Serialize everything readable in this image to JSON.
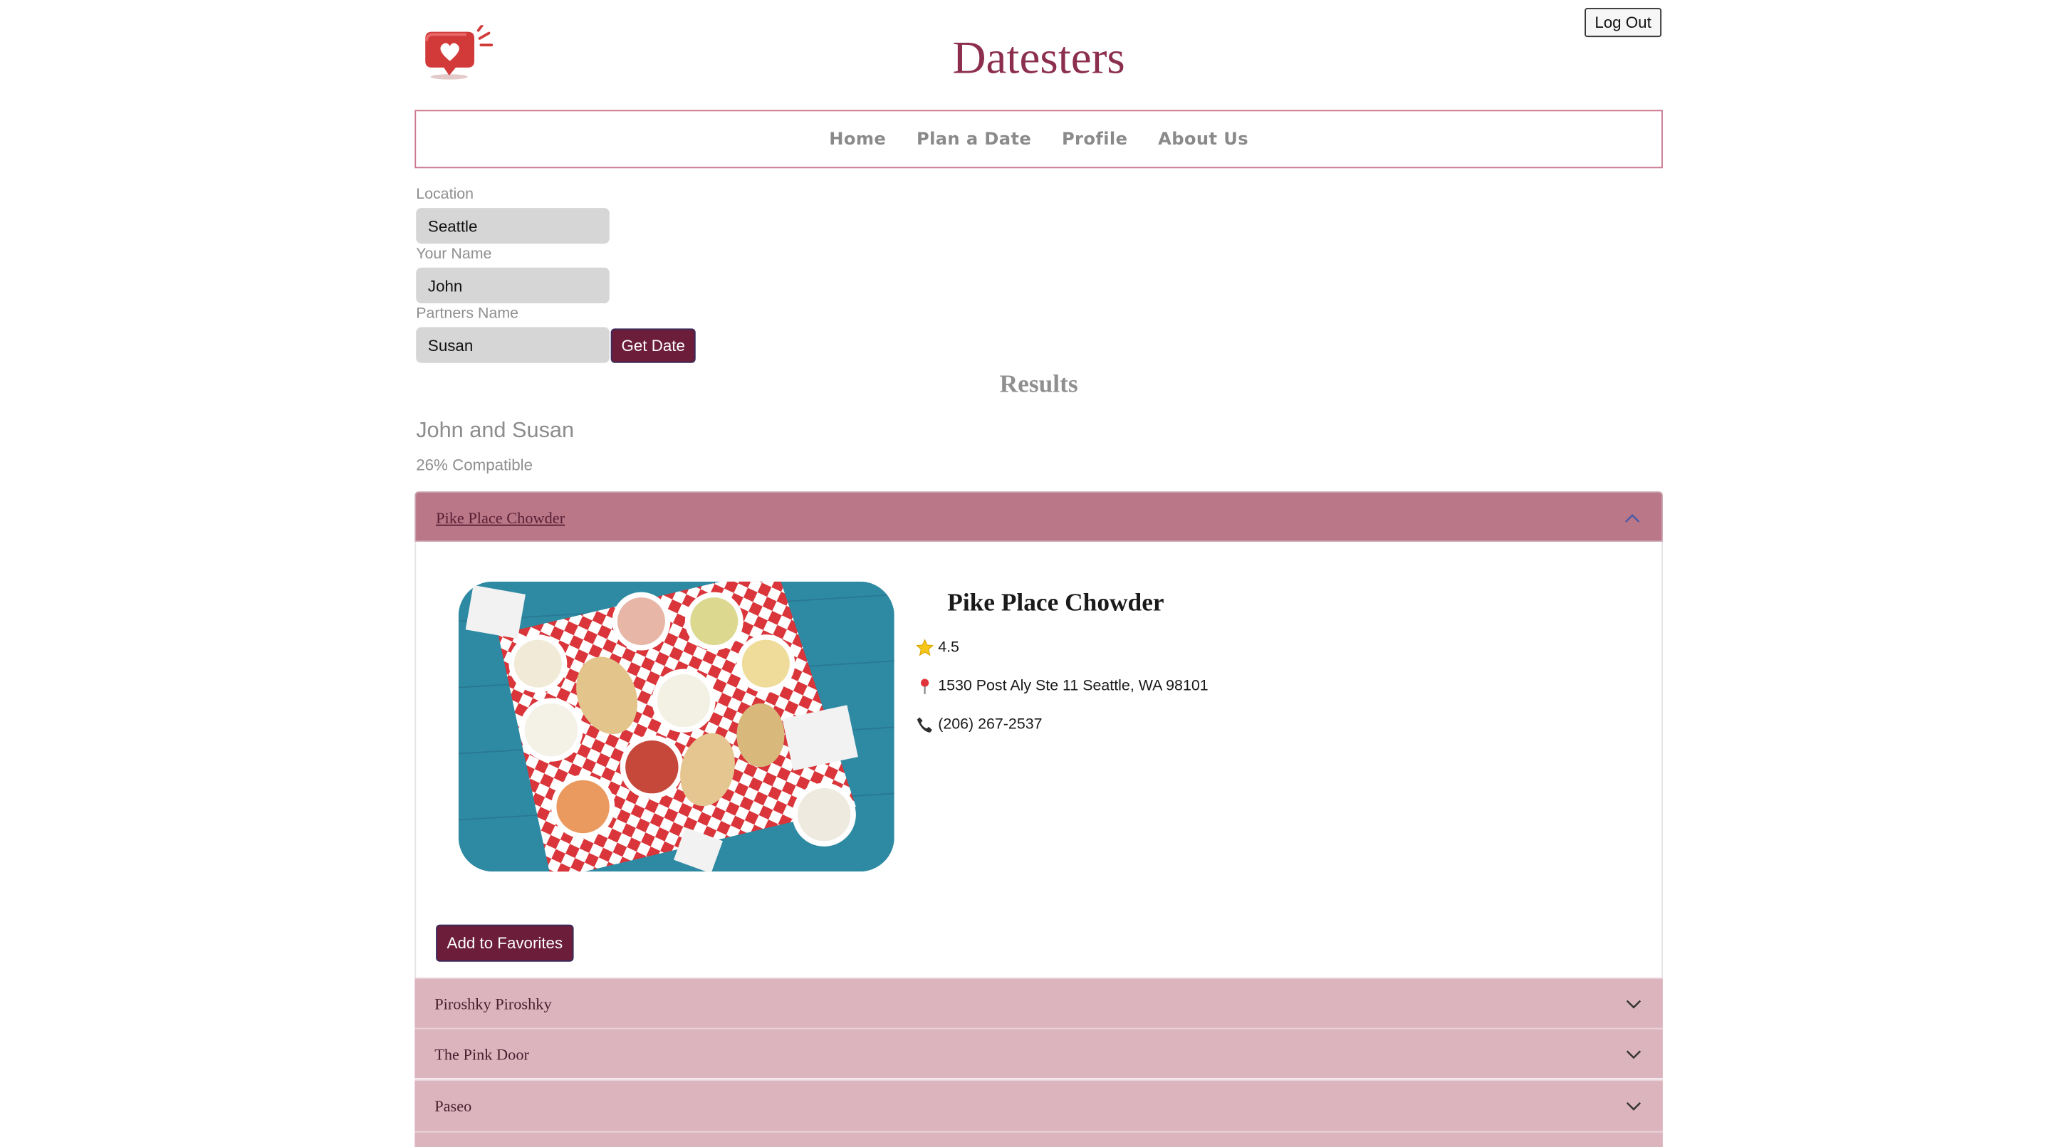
{
  "header": {
    "site_title": "Datesters",
    "logout_label": "Log Out"
  },
  "nav": {
    "items": [
      {
        "label": "Home"
      },
      {
        "label": "Plan a Date"
      },
      {
        "label": "Profile"
      },
      {
        "label": "About Us"
      }
    ]
  },
  "form": {
    "location_label": "Location",
    "location_value": "Seattle",
    "your_name_label": "Your Name",
    "your_name_value": "John",
    "partner_name_label": "Partners Name",
    "partner_name_value": "Susan",
    "submit_label": "Get Date"
  },
  "results": {
    "heading": "Results",
    "pair": "John and Susan",
    "compatibility": "26% Compatible"
  },
  "accordion": {
    "open_item": {
      "title": "Pike Place Chowder",
      "name": "Pike Place Chowder",
      "rating": "4.5",
      "address": "1530 Post Aly Ste 11 Seattle, WA 98101",
      "phone": "(206) 267-2537",
      "favorite_label": "Add to Favorites"
    },
    "items": [
      {
        "title": "Piroshky Piroshky"
      },
      {
        "title": "The Pink Door"
      },
      {
        "title": "Paseo"
      }
    ]
  },
  "colors": {
    "brand": "#8c2f4f",
    "button": "#6b1d3a",
    "accordion_open": "#b97788",
    "accordion_closed": "#dbb4be"
  },
  "icons": [
    "heart-notification-logo",
    "star-icon",
    "map-pin-icon",
    "phone-icon",
    "chevron-up-icon",
    "chevron-down-icon"
  ]
}
